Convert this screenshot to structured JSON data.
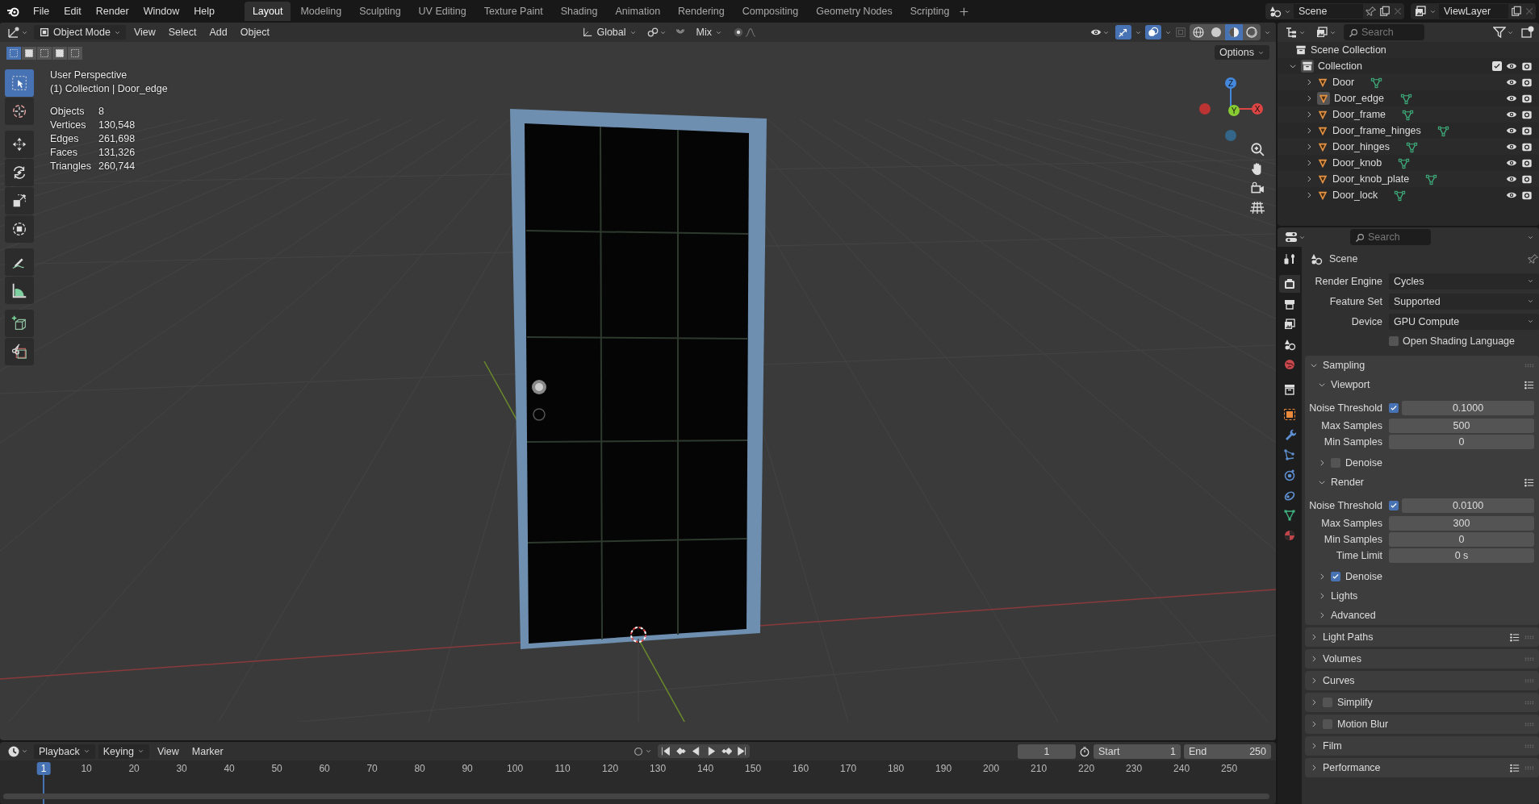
{
  "topbar": {
    "menu": [
      "File",
      "Edit",
      "Render",
      "Window",
      "Help"
    ],
    "workspaces": [
      {
        "label": "Layout",
        "selected": true
      },
      {
        "label": "Modeling",
        "selected": false
      },
      {
        "label": "Sculpting",
        "selected": false
      },
      {
        "label": "UV Editing",
        "selected": false
      },
      {
        "label": "Texture Paint",
        "selected": false
      },
      {
        "label": "Shading",
        "selected": false
      },
      {
        "label": "Animation",
        "selected": false
      },
      {
        "label": "Rendering",
        "selected": false
      },
      {
        "label": "Compositing",
        "selected": false
      },
      {
        "label": "Geometry Nodes",
        "selected": false
      },
      {
        "label": "Scripting",
        "selected": false
      }
    ],
    "scene": "Scene",
    "view_layer": "ViewLayer"
  },
  "viewport": {
    "mode": "Object Mode",
    "menus": [
      "View",
      "Select",
      "Add",
      "Object"
    ],
    "orientation": "Global",
    "blend": "Mix",
    "options": "Options",
    "select_modes": [
      {
        "selected": true
      },
      {
        "selected": false
      },
      {
        "selected": false
      },
      {
        "selected": false
      },
      {
        "selected": false
      }
    ],
    "gizmos_on": true,
    "overlays_on": true,
    "shading": [
      {
        "kind": "wireframe",
        "selected": false
      },
      {
        "kind": "solid",
        "selected": false
      },
      {
        "kind": "material",
        "selected": true
      },
      {
        "kind": "rendered",
        "selected": false
      }
    ],
    "tools": [
      {
        "kind": "select",
        "selected": true
      },
      {
        "kind": "cursor",
        "selected": false
      },
      {
        "kind": "move",
        "selected": false
      },
      {
        "kind": "rotate",
        "selected": false
      },
      {
        "kind": "scale",
        "selected": false
      },
      {
        "kind": "transform",
        "selected": false
      },
      {
        "kind": "annotate",
        "selected": false
      },
      {
        "kind": "measure",
        "selected": false
      },
      {
        "kind": "add_cube",
        "selected": false
      },
      {
        "kind": "cut",
        "selected": false
      }
    ],
    "view_name": "User Perspective",
    "context": "(1) Collection | Door_edge",
    "stats": [
      {
        "label": "Objects",
        "value": "8"
      },
      {
        "label": "Vertices",
        "value": "130,548"
      },
      {
        "label": "Edges",
        "value": "261,698"
      },
      {
        "label": "Faces",
        "value": "131,326"
      },
      {
        "label": "Triangles",
        "value": "260,744"
      }
    ],
    "gizmo": {
      "x": "X",
      "y": "Y",
      "z": "Z"
    }
  },
  "timeline": {
    "menus": [
      "Playback",
      "Keying",
      "View",
      "Marker"
    ],
    "current_frame": "1",
    "start_label": "Start",
    "start": "1",
    "end_label": "End",
    "end": "250",
    "playhead": "1",
    "ruler": [
      "10",
      "20",
      "30",
      "40",
      "50",
      "60",
      "70",
      "80",
      "90",
      "100",
      "110",
      "120",
      "130",
      "140",
      "150",
      "160",
      "170",
      "180",
      "190",
      "200",
      "210",
      "220",
      "230",
      "240",
      "250"
    ]
  },
  "outliner": {
    "search_placeholder": "Search",
    "root": "Scene Collection",
    "collection": {
      "name": "Collection",
      "expanded": true,
      "checked": true,
      "children": [
        {
          "name": "Door",
          "active": false
        },
        {
          "name": "Door_edge",
          "active": true
        },
        {
          "name": "Door_frame",
          "active": false
        },
        {
          "name": "Door_frame_hinges",
          "active": false
        },
        {
          "name": "Door_hinges",
          "active": false
        },
        {
          "name": "Door_knob",
          "active": false
        },
        {
          "name": "Door_knob_plate",
          "active": false
        },
        {
          "name": "Door_lock",
          "active": false
        }
      ]
    }
  },
  "properties": {
    "search_placeholder": "Search",
    "context": "Scene",
    "tabs": [
      {
        "kind": "tool",
        "selected": false
      },
      {
        "kind": "render",
        "selected": true
      },
      {
        "kind": "output",
        "selected": false
      },
      {
        "kind": "view_layer",
        "selected": false
      },
      {
        "kind": "scene",
        "selected": false
      },
      {
        "kind": "world",
        "selected": false
      },
      {
        "kind": "collection",
        "selected": false
      },
      {
        "kind": "object",
        "selected": false
      },
      {
        "kind": "modifiers",
        "selected": false
      },
      {
        "kind": "particles",
        "selected": false
      },
      {
        "kind": "physics",
        "selected": false
      },
      {
        "kind": "constraints",
        "selected": false
      },
      {
        "kind": "data",
        "selected": false
      },
      {
        "kind": "material",
        "selected": false
      }
    ],
    "fields": [
      {
        "label": "Render Engine",
        "value": "Cycles"
      },
      {
        "label": "Feature Set",
        "value": "Supported"
      },
      {
        "label": "Device",
        "value": "GPU Compute"
      }
    ],
    "osl": {
      "label": "Open Shading Language",
      "checked": false
    },
    "panels": [
      {
        "title": "Sampling",
        "kind": "plain",
        "expanded": true,
        "presets": false,
        "children": [
          {
            "title": "Viewport",
            "kind": "plain",
            "expanded": true,
            "presets": true,
            "rows": [
              {
                "kind": "toggle_number",
                "label": "Noise Threshold",
                "checked": true,
                "value": "0.1000"
              },
              {
                "kind": "number",
                "label": "Max Samples",
                "value": "500"
              },
              {
                "kind": "number",
                "label": "Min Samples",
                "value": "0"
              }
            ]
          },
          {
            "title": "Denoise",
            "kind": "toggle",
            "checked": false,
            "expanded": false,
            "presets": false
          },
          {
            "title": "Render",
            "kind": "plain",
            "expanded": true,
            "presets": true,
            "rows": [
              {
                "kind": "toggle_number",
                "label": "Noise Threshold",
                "checked": true,
                "value": "0.0100"
              },
              {
                "kind": "number",
                "label": "Max Samples",
                "value": "300"
              },
              {
                "kind": "number",
                "label": "Min Samples",
                "value": "0"
              },
              {
                "kind": "number",
                "label": "Time Limit",
                "value": "0 s"
              }
            ]
          },
          {
            "title": "Denoise",
            "kind": "toggle",
            "checked": true,
            "expanded": false,
            "presets": false
          },
          {
            "title": "Lights",
            "kind": "plain",
            "expanded": false,
            "presets": false
          },
          {
            "title": "Advanced",
            "kind": "plain",
            "expanded": false,
            "presets": false
          }
        ]
      },
      {
        "title": "Light Paths",
        "kind": "plain",
        "expanded": false,
        "presets": true
      },
      {
        "title": "Volumes",
        "kind": "plain",
        "expanded": false,
        "presets": false
      },
      {
        "title": "Curves",
        "kind": "plain",
        "expanded": false,
        "presets": false
      },
      {
        "title": "Simplify",
        "kind": "toggle",
        "checked": false,
        "expanded": false,
        "presets": false
      },
      {
        "title": "Motion Blur",
        "kind": "toggle",
        "checked": false,
        "expanded": false,
        "presets": false
      },
      {
        "title": "Film",
        "kind": "plain",
        "expanded": false,
        "presets": false
      },
      {
        "title": "Performance",
        "kind": "plain",
        "expanded": false,
        "presets": true
      }
    ]
  }
}
